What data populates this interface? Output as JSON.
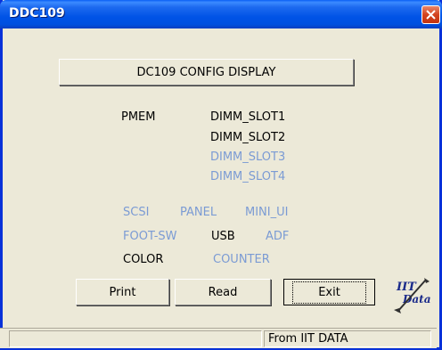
{
  "window": {
    "title": "DDC109"
  },
  "header_button": "DC109 CONFIG DISPLAY",
  "pmem": {
    "label": "PMEM",
    "slots": [
      {
        "label": "DIMM_SLOT1",
        "active": true
      },
      {
        "label": "DIMM_SLOT2",
        "active": true
      },
      {
        "label": "DIMM_SLOT3",
        "active": false
      },
      {
        "label": "DIMM_SLOT4",
        "active": false
      }
    ]
  },
  "options": {
    "scsi": {
      "label": "SCSI",
      "active": false
    },
    "panel": {
      "label": "PANEL",
      "active": false
    },
    "mini_ui": {
      "label": "MINI_UI",
      "active": false
    },
    "foot_sw": {
      "label": "FOOT-SW",
      "active": false
    },
    "usb": {
      "label": "USB",
      "active": true
    },
    "adf": {
      "label": "ADF",
      "active": false
    },
    "color": {
      "label": "COLOR",
      "active": true
    },
    "counter": {
      "label": "COUNTER",
      "active": false
    }
  },
  "buttons": {
    "print": "Print",
    "read": "Read",
    "exit": "Exit"
  },
  "logo_text": "IIT Data",
  "statusbar": {
    "pane1": "",
    "pane2": "From IIT DATA"
  },
  "colors": {
    "active_text": "#000000",
    "inactive_text": "#7b9bd4",
    "titlebar": "#0053e6",
    "window_bg": "#ece9d8"
  }
}
